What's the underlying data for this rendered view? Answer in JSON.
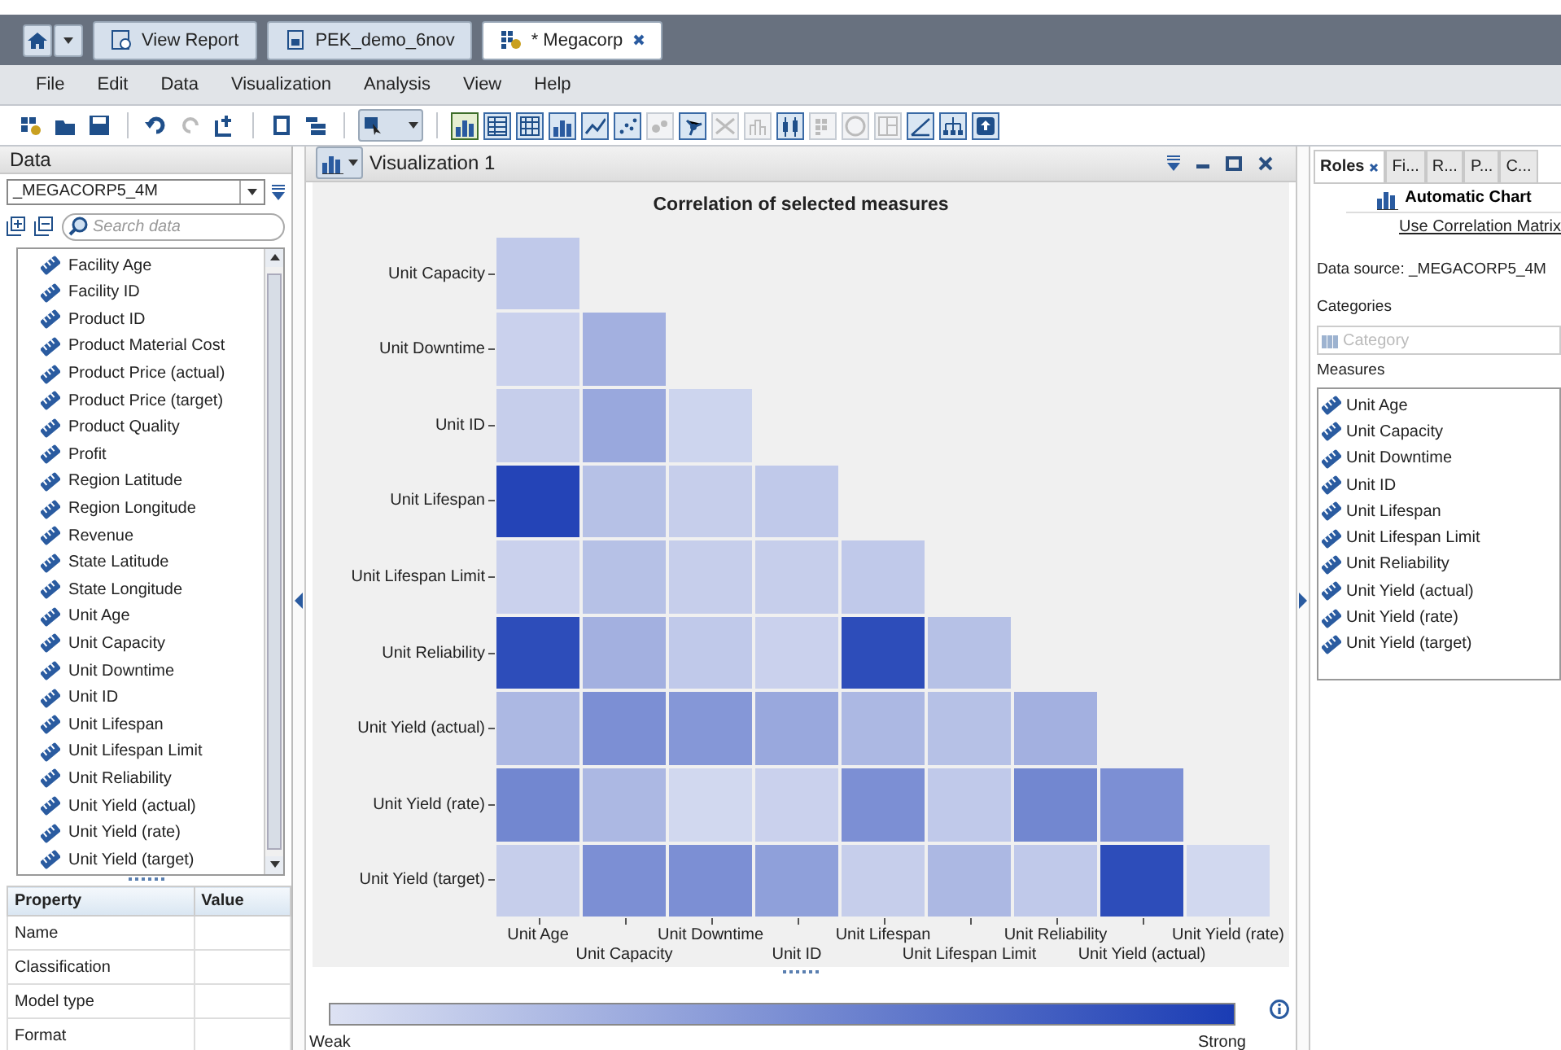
{
  "doc_tabs": [
    {
      "label": "View Report",
      "selected": false,
      "closable": false
    },
    {
      "label": "PEK_demo_6nov",
      "selected": false,
      "closable": false
    },
    {
      "label": "* Megacorp",
      "selected": true,
      "closable": true
    }
  ],
  "menu": [
    "File",
    "Edit",
    "Data",
    "Visualization",
    "Analysis",
    "View",
    "Help"
  ],
  "chart_buttons": [
    {
      "selected": true,
      "disabled": false
    },
    {
      "selected": false,
      "disabled": false
    },
    {
      "selected": false,
      "disabled": false
    },
    {
      "selected": false,
      "disabled": false
    },
    {
      "selected": false,
      "disabled": false
    },
    {
      "selected": false,
      "disabled": false
    },
    {
      "selected": false,
      "disabled": true
    },
    {
      "selected": false,
      "disabled": false
    },
    {
      "selected": false,
      "disabled": true
    },
    {
      "selected": false,
      "disabled": true
    },
    {
      "selected": false,
      "disabled": false
    },
    {
      "selected": false,
      "disabled": true
    },
    {
      "selected": false,
      "disabled": true
    },
    {
      "selected": false,
      "disabled": true
    },
    {
      "selected": false,
      "disabled": false
    },
    {
      "selected": false,
      "disabled": false
    },
    {
      "selected": false,
      "disabled": false
    }
  ],
  "data_panel": {
    "title": "Data",
    "source": "_MEGACORP5_4M",
    "search": {
      "placeholder": "Search data"
    },
    "items": [
      "Facility Age",
      "Facility ID",
      "Product ID",
      "Product Material Cost",
      "Product Price (actual)",
      "Product Price (target)",
      "Product Quality",
      "Profit",
      "Region Latitude",
      "Region Longitude",
      "Revenue",
      "State Latitude",
      "State Longitude",
      "Unit Age",
      "Unit Capacity",
      "Unit Downtime",
      "Unit ID",
      "Unit Lifespan",
      "Unit Lifespan Limit",
      "Unit Reliability",
      "Unit Yield (actual)",
      "Unit Yield (rate)",
      "Unit Yield (target)"
    ],
    "properties": {
      "columns": [
        "Property",
        "Value"
      ],
      "rows": [
        "Name",
        "Classification",
        "Model type",
        "Format"
      ]
    }
  },
  "visualization": {
    "title": "Visualization 1",
    "chart_title": "Correlation of selected measures",
    "row_labels": [
      "Unit Capacity",
      "Unit Downtime",
      "Unit ID",
      "Unit Lifespan",
      "Unit Lifespan Limit",
      "Unit Reliability",
      "Unit Yield (actual)",
      "Unit Yield (rate)",
      "Unit Yield (target)"
    ],
    "column_labels": [
      "Unit Age",
      "Unit Capacity",
      "Unit Downtime",
      "Unit ID",
      "Unit Lifespan",
      "Unit Lifespan Limit",
      "Unit Reliability",
      "Unit Yield (actual)",
      "Unit Yield (rate)"
    ],
    "cells": [
      [
        {
          "color": "#c0c9ea"
        }
      ],
      [
        {
          "color": "#cad1ed"
        },
        {
          "color": "#a3b0e0"
        }
      ],
      [
        {
          "color": "#c6ceeb"
        },
        {
          "color": "#99a8dd"
        },
        {
          "color": "#cdd5ee"
        }
      ],
      [
        {
          "color": "#2444b7"
        },
        {
          "color": "#b6c1e6"
        },
        {
          "color": "#c6ceeb"
        },
        {
          "color": "#c0c9ea"
        }
      ],
      [
        {
          "color": "#cad1ed"
        },
        {
          "color": "#b6c1e6"
        },
        {
          "color": "#c6ceeb"
        },
        {
          "color": "#c6ceeb"
        },
        {
          "color": "#c0c9ea"
        }
      ],
      [
        {
          "color": "#2d4dba"
        },
        {
          "color": "#a3b0e0"
        },
        {
          "color": "#c0c9ea"
        },
        {
          "color": "#cad1ed"
        },
        {
          "color": "#2d4dba"
        },
        {
          "color": "#b6c1e6"
        }
      ],
      [
        {
          "color": "#acb8e3"
        },
        {
          "color": "#7c8fd4"
        },
        {
          "color": "#8597d7"
        },
        {
          "color": "#99a8dd"
        },
        {
          "color": "#acb8e3"
        },
        {
          "color": "#b6c1e6"
        },
        {
          "color": "#a3b0e0"
        }
      ],
      [
        {
          "color": "#7287d0"
        },
        {
          "color": "#acb8e3"
        },
        {
          "color": "#d1d8ef"
        },
        {
          "color": "#cad1ed"
        },
        {
          "color": "#7c8fd4"
        },
        {
          "color": "#c0c9ea"
        },
        {
          "color": "#7287d0"
        },
        {
          "color": "#7c8fd4"
        }
      ],
      [
        {
          "color": "#c6ceeb"
        },
        {
          "color": "#7c8fd4"
        },
        {
          "color": "#7c8fd4"
        },
        {
          "color": "#8fa0da"
        },
        {
          "color": "#c6ceeb"
        },
        {
          "color": "#acb8e3"
        },
        {
          "color": "#c0c9ea"
        },
        {
          "color": "#2d4dba"
        },
        {
          "color": "#d1d8ef"
        }
      ]
    ],
    "legend": {
      "low": "Weak",
      "high": "Strong"
    }
  },
  "roles_panel": {
    "tabs": [
      {
        "label": "Roles",
        "selected": true
      },
      {
        "label": "Fi...",
        "selected": false
      },
      {
        "label": "R...",
        "selected": false
      },
      {
        "label": "P...",
        "selected": false
      },
      {
        "label": "C...",
        "selected": false
      }
    ],
    "chart_type": "Automatic Chart",
    "link": "Use Correlation Matrix",
    "data_source": "Data source: _MEGACORP5_4M",
    "categories_label": "Categories",
    "category_placeholder": "Category",
    "measures_label": "Measures",
    "measures": [
      "Unit Age",
      "Unit Capacity",
      "Unit Downtime",
      "Unit ID",
      "Unit Lifespan",
      "Unit Lifespan Limit",
      "Unit Reliability",
      "Unit Yield (actual)",
      "Unit Yield (rate)",
      "Unit Yield (target)"
    ]
  }
}
